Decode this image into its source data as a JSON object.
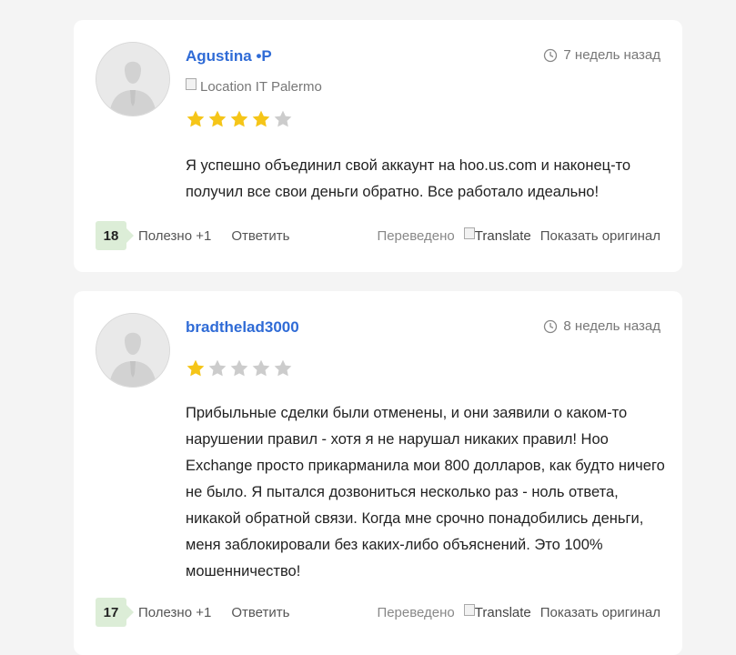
{
  "reviews": [
    {
      "username": "Agustina •P",
      "time": "7 недель назад",
      "location": "Location",
      "location_text": "IT Palermo",
      "rating": 4,
      "text": "Я успешно объединил свой аккаунт на hoo.us.com и наконец-то получил все свои деньги обратно. Все работало идеально!",
      "helpful_count": "18",
      "helpful_label": "Полезно +1",
      "reply_label": "Ответить",
      "translated_label": "Переведено",
      "translate_alt": "Translate",
      "show_original_label": "Показать оригинал"
    },
    {
      "username": "bradthelad3000",
      "time": "8 недель назад",
      "rating": 1,
      "text": "Прибыльные сделки были отменены, и они заявили о каком-то нарушении правил - хотя я не нарушал никаких правил! Hoo Exchange просто прикарманила мои 800 долларов, как будто ничего не было. Я пытался дозвониться несколько раз - ноль ответа, никакой обратной связи. Когда мне срочно понадобились деньги, меня заблокировали без каких-либо объяснений. Это 100% мошенничество!",
      "helpful_count": "17",
      "helpful_label": "Полезно +1",
      "reply_label": "Ответить",
      "translated_label": "Переведено",
      "translate_alt": "Translate",
      "show_original_label": "Показать оригинал"
    }
  ],
  "colors": {
    "username": "#2f6bd6",
    "star_filled": "#f5c518",
    "star_empty": "#cccccc",
    "badge_bg": "#dcedd7"
  },
  "icons": [
    "clock-icon",
    "avatar-silhouette-icon",
    "star-icon",
    "broken-image-icon"
  ]
}
